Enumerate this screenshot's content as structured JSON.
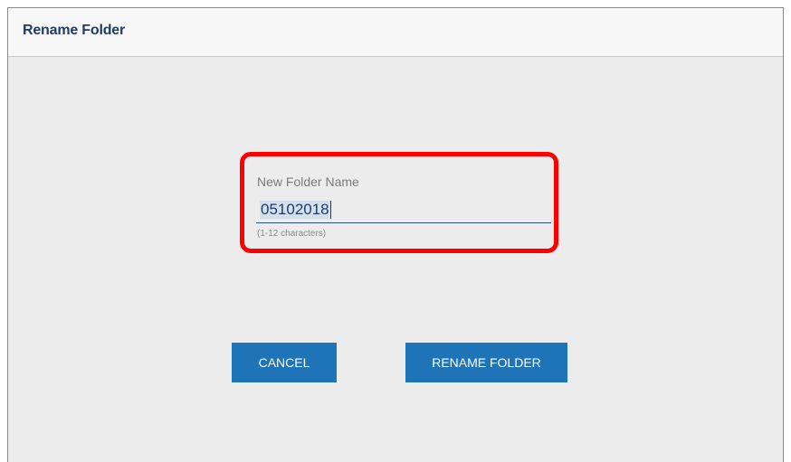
{
  "dialog": {
    "title": "Rename Folder"
  },
  "form": {
    "label": "New Folder Name",
    "value": "05102018",
    "hint": "(1-12 characters)"
  },
  "actions": {
    "cancel_label": "CANCEL",
    "rename_label": "RENAME FOLDER"
  },
  "colors": {
    "title": "#1d3d66",
    "button": "#1f74b8",
    "highlight_border": "#ff0000"
  }
}
